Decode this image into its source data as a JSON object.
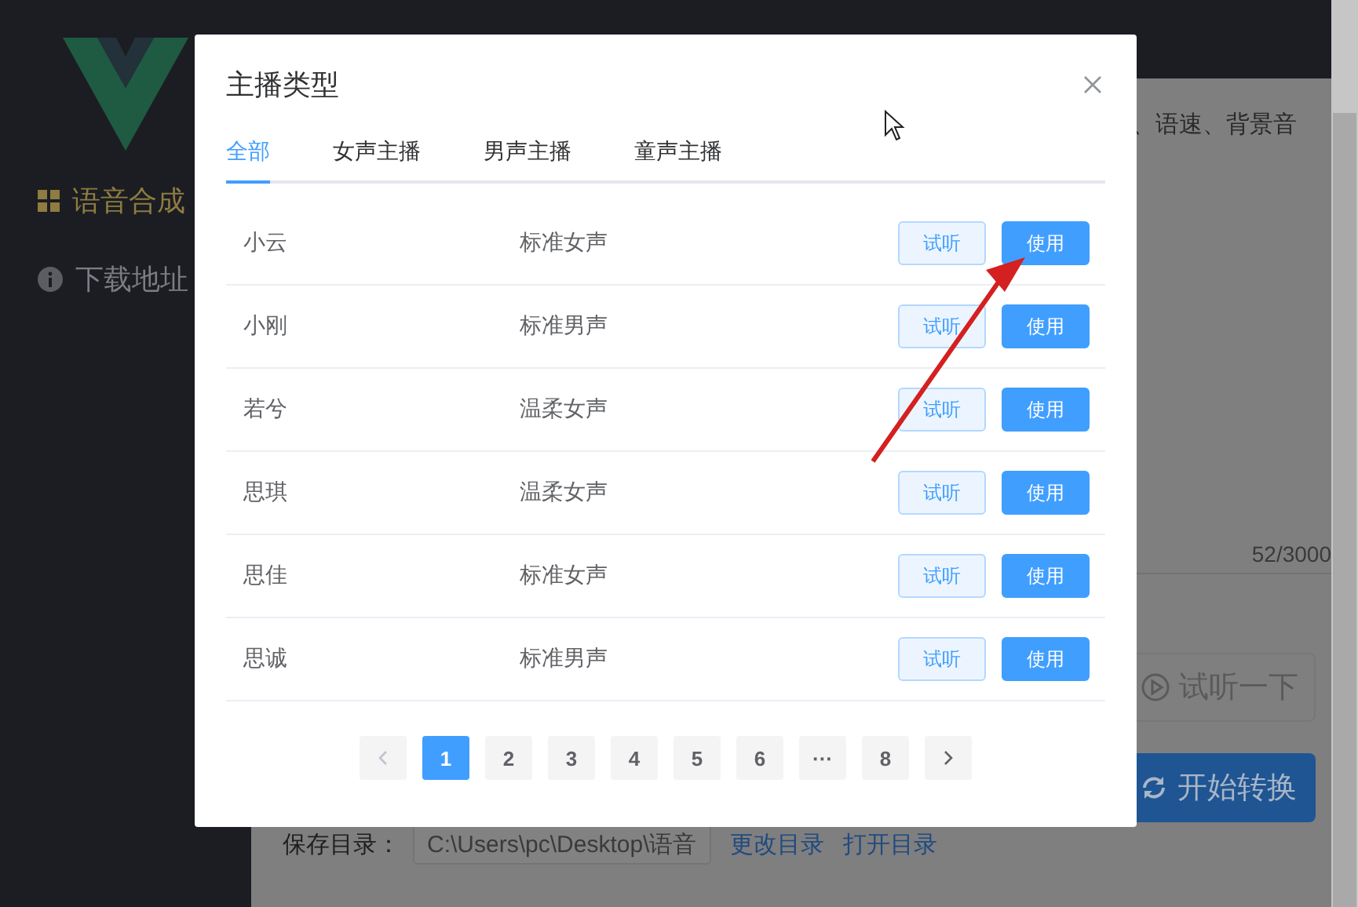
{
  "sidebar": {
    "items": [
      {
        "label": "语音合成",
        "selected": true
      },
      {
        "label": "下载地址",
        "selected": false
      }
    ]
  },
  "main": {
    "hint": "、语速、背景音",
    "char_count": "52/3000",
    "preview_button": "试听一下",
    "convert_button": "开始转换",
    "save_dir": {
      "label": "保存目录：",
      "value": "C:\\Users\\pc\\Desktop\\语音",
      "links": [
        "更改目录",
        "打开目录"
      ]
    }
  },
  "dialog": {
    "title": "主播类型",
    "tabs": [
      {
        "label": "全部",
        "selected": true
      },
      {
        "label": "女声主播",
        "selected": false
      },
      {
        "label": "男声主播",
        "selected": false
      },
      {
        "label": "童声主播",
        "selected": false
      }
    ],
    "rows": [
      {
        "name": "小云",
        "type": "标准女声",
        "listen": "试听",
        "use": "使用"
      },
      {
        "name": "小刚",
        "type": "标准男声",
        "listen": "试听",
        "use": "使用"
      },
      {
        "name": "若兮",
        "type": "温柔女声",
        "listen": "试听",
        "use": "使用"
      },
      {
        "name": "思琪",
        "type": "温柔女声",
        "listen": "试听",
        "use": "使用"
      },
      {
        "name": "思佳",
        "type": "标准女声",
        "listen": "试听",
        "use": "使用"
      },
      {
        "name": "思诚",
        "type": "标准男声",
        "listen": "试听",
        "use": "使用"
      }
    ],
    "pagination": {
      "prev": {
        "disabled": true
      },
      "next": {
        "disabled": false
      },
      "pages": [
        {
          "label": "1",
          "selected": true
        },
        {
          "label": "2",
          "selected": false
        },
        {
          "label": "3",
          "selected": false
        },
        {
          "label": "4",
          "selected": false
        },
        {
          "label": "5",
          "selected": false
        },
        {
          "label": "6",
          "selected": false
        },
        {
          "label": "···",
          "selected": false
        },
        {
          "label": "8",
          "selected": false
        }
      ]
    }
  }
}
